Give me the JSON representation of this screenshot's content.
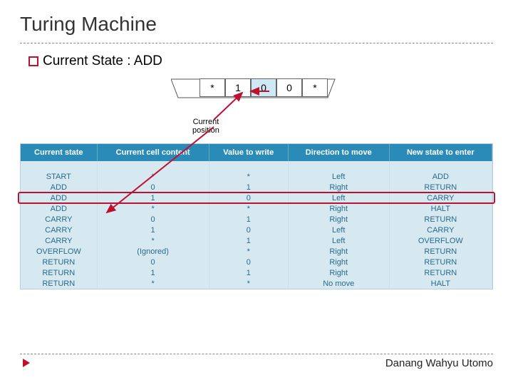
{
  "title": "Turing Machine",
  "state_label": "Current State : ADD",
  "tape": {
    "cells": [
      "*",
      "1",
      "0",
      "0",
      "*"
    ],
    "highlight_index": 2
  },
  "cp_label": "Current\nposition",
  "table": {
    "headers": [
      "Current state",
      "Current cell content",
      "Value to write",
      "Direction to move",
      "New state to enter"
    ],
    "rows": [
      [
        "START",
        "*",
        "*",
        "Left",
        "ADD"
      ],
      [
        "ADD",
        "0",
        "1",
        "Right",
        "RETURN"
      ],
      [
        "ADD",
        "1",
        "0",
        "Left",
        "CARRY"
      ],
      [
        "ADD",
        "*",
        "*",
        "Right",
        "HALT"
      ],
      [
        "CARRY",
        "0",
        "1",
        "Right",
        "RETURN"
      ],
      [
        "CARRY",
        "1",
        "0",
        "Left",
        "CARRY"
      ],
      [
        "CARRY",
        "*",
        "1",
        "Left",
        "OVERFLOW"
      ],
      [
        "OVERFLOW",
        "(Ignored)",
        "*",
        "Right",
        "RETURN"
      ],
      [
        "RETURN",
        "0",
        "0",
        "Right",
        "RETURN"
      ],
      [
        "RETURN",
        "1",
        "1",
        "Right",
        "RETURN"
      ],
      [
        "RETURN",
        "*",
        "*",
        "No move",
        "HALT"
      ]
    ],
    "highlight_row": 2
  },
  "footer": "Danang Wahyu Utomo"
}
